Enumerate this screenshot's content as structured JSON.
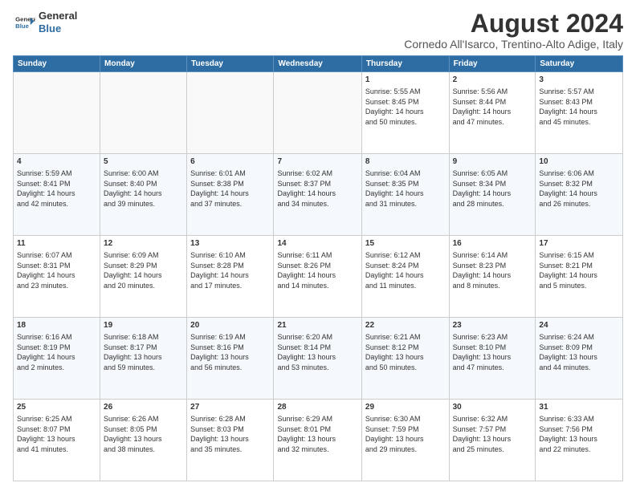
{
  "header": {
    "logo_line1": "General",
    "logo_line2": "Blue",
    "title": "August 2024",
    "subtitle": "Cornedo All'Isarco, Trentino-Alto Adige, Italy"
  },
  "days_of_week": [
    "Sunday",
    "Monday",
    "Tuesday",
    "Wednesday",
    "Thursday",
    "Friday",
    "Saturday"
  ],
  "weeks": [
    [
      {
        "day": "",
        "info": ""
      },
      {
        "day": "",
        "info": ""
      },
      {
        "day": "",
        "info": ""
      },
      {
        "day": "",
        "info": ""
      },
      {
        "day": "1",
        "info": "Sunrise: 5:55 AM\nSunset: 8:45 PM\nDaylight: 14 hours\nand 50 minutes."
      },
      {
        "day": "2",
        "info": "Sunrise: 5:56 AM\nSunset: 8:44 PM\nDaylight: 14 hours\nand 47 minutes."
      },
      {
        "day": "3",
        "info": "Sunrise: 5:57 AM\nSunset: 8:43 PM\nDaylight: 14 hours\nand 45 minutes."
      }
    ],
    [
      {
        "day": "4",
        "info": "Sunrise: 5:59 AM\nSunset: 8:41 PM\nDaylight: 14 hours\nand 42 minutes."
      },
      {
        "day": "5",
        "info": "Sunrise: 6:00 AM\nSunset: 8:40 PM\nDaylight: 14 hours\nand 39 minutes."
      },
      {
        "day": "6",
        "info": "Sunrise: 6:01 AM\nSunset: 8:38 PM\nDaylight: 14 hours\nand 37 minutes."
      },
      {
        "day": "7",
        "info": "Sunrise: 6:02 AM\nSunset: 8:37 PM\nDaylight: 14 hours\nand 34 minutes."
      },
      {
        "day": "8",
        "info": "Sunrise: 6:04 AM\nSunset: 8:35 PM\nDaylight: 14 hours\nand 31 minutes."
      },
      {
        "day": "9",
        "info": "Sunrise: 6:05 AM\nSunset: 8:34 PM\nDaylight: 14 hours\nand 28 minutes."
      },
      {
        "day": "10",
        "info": "Sunrise: 6:06 AM\nSunset: 8:32 PM\nDaylight: 14 hours\nand 26 minutes."
      }
    ],
    [
      {
        "day": "11",
        "info": "Sunrise: 6:07 AM\nSunset: 8:31 PM\nDaylight: 14 hours\nand 23 minutes."
      },
      {
        "day": "12",
        "info": "Sunrise: 6:09 AM\nSunset: 8:29 PM\nDaylight: 14 hours\nand 20 minutes."
      },
      {
        "day": "13",
        "info": "Sunrise: 6:10 AM\nSunset: 8:28 PM\nDaylight: 14 hours\nand 17 minutes."
      },
      {
        "day": "14",
        "info": "Sunrise: 6:11 AM\nSunset: 8:26 PM\nDaylight: 14 hours\nand 14 minutes."
      },
      {
        "day": "15",
        "info": "Sunrise: 6:12 AM\nSunset: 8:24 PM\nDaylight: 14 hours\nand 11 minutes."
      },
      {
        "day": "16",
        "info": "Sunrise: 6:14 AM\nSunset: 8:23 PM\nDaylight: 14 hours\nand 8 minutes."
      },
      {
        "day": "17",
        "info": "Sunrise: 6:15 AM\nSunset: 8:21 PM\nDaylight: 14 hours\nand 5 minutes."
      }
    ],
    [
      {
        "day": "18",
        "info": "Sunrise: 6:16 AM\nSunset: 8:19 PM\nDaylight: 14 hours\nand 2 minutes."
      },
      {
        "day": "19",
        "info": "Sunrise: 6:18 AM\nSunset: 8:17 PM\nDaylight: 13 hours\nand 59 minutes."
      },
      {
        "day": "20",
        "info": "Sunrise: 6:19 AM\nSunset: 8:16 PM\nDaylight: 13 hours\nand 56 minutes."
      },
      {
        "day": "21",
        "info": "Sunrise: 6:20 AM\nSunset: 8:14 PM\nDaylight: 13 hours\nand 53 minutes."
      },
      {
        "day": "22",
        "info": "Sunrise: 6:21 AM\nSunset: 8:12 PM\nDaylight: 13 hours\nand 50 minutes."
      },
      {
        "day": "23",
        "info": "Sunrise: 6:23 AM\nSunset: 8:10 PM\nDaylight: 13 hours\nand 47 minutes."
      },
      {
        "day": "24",
        "info": "Sunrise: 6:24 AM\nSunset: 8:09 PM\nDaylight: 13 hours\nand 44 minutes."
      }
    ],
    [
      {
        "day": "25",
        "info": "Sunrise: 6:25 AM\nSunset: 8:07 PM\nDaylight: 13 hours\nand 41 minutes."
      },
      {
        "day": "26",
        "info": "Sunrise: 6:26 AM\nSunset: 8:05 PM\nDaylight: 13 hours\nand 38 minutes."
      },
      {
        "day": "27",
        "info": "Sunrise: 6:28 AM\nSunset: 8:03 PM\nDaylight: 13 hours\nand 35 minutes."
      },
      {
        "day": "28",
        "info": "Sunrise: 6:29 AM\nSunset: 8:01 PM\nDaylight: 13 hours\nand 32 minutes."
      },
      {
        "day": "29",
        "info": "Sunrise: 6:30 AM\nSunset: 7:59 PM\nDaylight: 13 hours\nand 29 minutes."
      },
      {
        "day": "30",
        "info": "Sunrise: 6:32 AM\nSunset: 7:57 PM\nDaylight: 13 hours\nand 25 minutes."
      },
      {
        "day": "31",
        "info": "Sunrise: 6:33 AM\nSunset: 7:56 PM\nDaylight: 13 hours\nand 22 minutes."
      }
    ]
  ]
}
